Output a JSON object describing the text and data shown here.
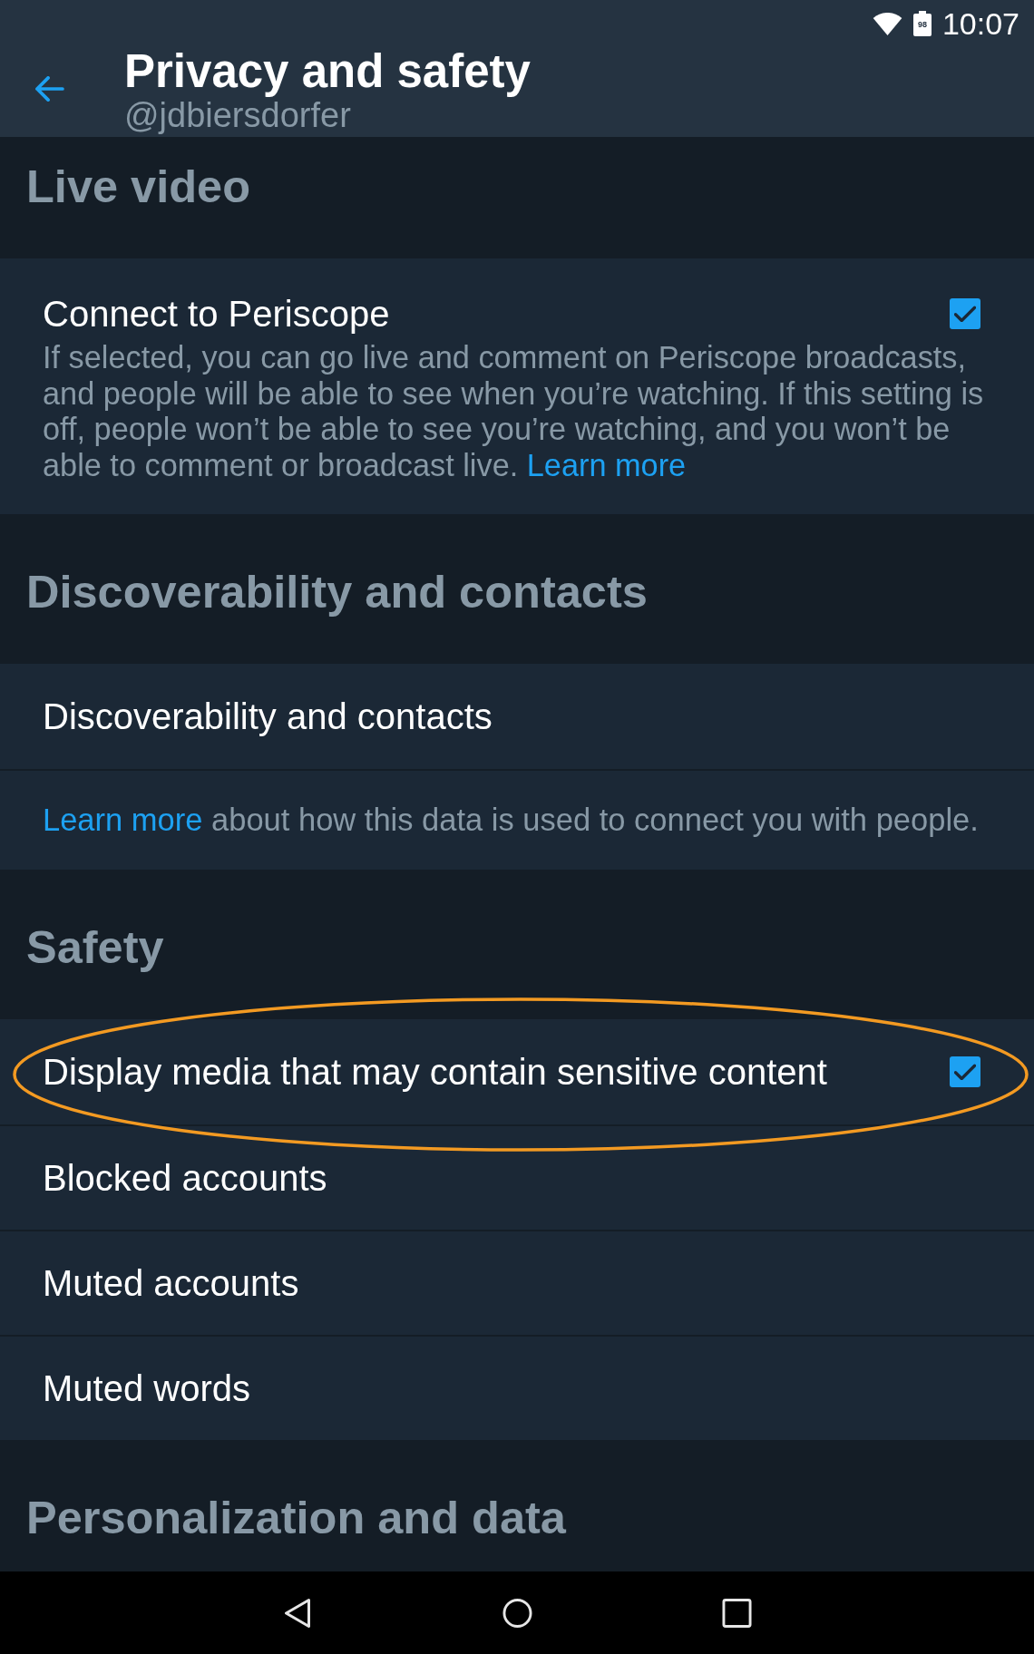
{
  "status_bar": {
    "battery": "98",
    "time": "10:07"
  },
  "header": {
    "title": "Privacy and safety",
    "subtitle": "@jdbiersdorfer"
  },
  "sections": [
    {
      "heading": "Live video",
      "items": [
        {
          "kind": "checkbox",
          "label": "Connect to Periscope",
          "description": "If selected, you can go live and comment on Periscope broadcasts, and people will be able to see when you’re watching. If this setting is off, people won’t be able to see you’re watching, and you won’t be able to comment or broadcast live.",
          "link": "Learn more",
          "checked": true,
          "highlighted": false
        }
      ]
    },
    {
      "heading": "Discoverability and contacts",
      "items": [
        {
          "kind": "link",
          "label": "Discoverability and contacts",
          "highlighted": false
        },
        {
          "kind": "note",
          "link": "Learn more",
          "text": "about how this data is used to connect you with people.",
          "highlighted": false
        }
      ]
    },
    {
      "heading": "Safety",
      "items": [
        {
          "kind": "checkbox",
          "label": "Display media that may contain sensitive content",
          "checked": true,
          "highlighted": true
        },
        {
          "kind": "link",
          "label": "Blocked accounts",
          "highlighted": false
        },
        {
          "kind": "link",
          "label": "Muted accounts",
          "highlighted": false
        },
        {
          "kind": "link",
          "label": "Muted words",
          "highlighted": false
        }
      ]
    },
    {
      "heading": "Personalization and data"
    }
  ]
}
